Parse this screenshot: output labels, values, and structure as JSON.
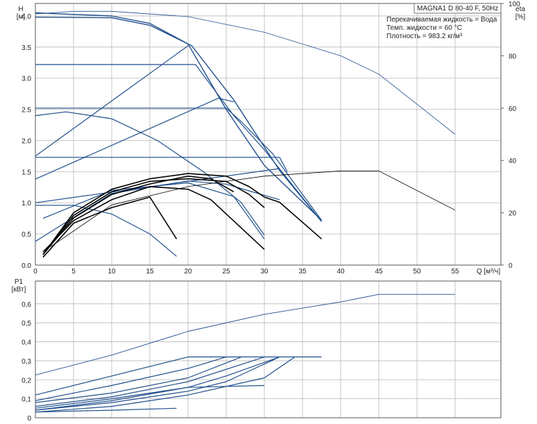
{
  "chart_data": [
    {
      "type": "line",
      "title": "MAGNA1 D 80-40 F, 50Hz",
      "ylabel": "H",
      "yunit": "[м]",
      "y2label": "eta",
      "y2unit": "[%]",
      "xlabel": "Q [м³/ч]",
      "xlim": [
        0,
        61
      ],
      "ylim": [
        0,
        4.2
      ],
      "y2lim": [
        0,
        100
      ],
      "xticks": [
        0,
        5,
        10,
        15,
        20,
        25,
        30,
        35,
        40,
        45,
        50,
        55
      ],
      "yticks": [
        0.0,
        0.5,
        1.0,
        1.5,
        2.0,
        2.5,
        3.0,
        3.5,
        4.0
      ],
      "y2ticks": [
        0,
        20,
        40,
        60,
        80,
        100
      ],
      "grid": true,
      "info_lines": [
        "Перекачиваемая жидкость = Вода",
        "Темп. жидкости = 60 °C",
        "Плотность = 983.2 кг/м³"
      ],
      "colors": {
        "curve": "#1f4e8c",
        "efficiency": "#000000",
        "grid": "#b8b8b8"
      },
      "series": [
        {
          "role": "max-curve",
          "points": [
            [
              0,
              4.05
            ],
            [
              10,
              4.0
            ],
            [
              15,
              3.88
            ],
            [
              20,
              3.55
            ],
            [
              25,
              2.5
            ],
            [
              30,
              1.6
            ],
            [
              37.5,
              0.72
            ]
          ]
        },
        {
          "role": "max-curve-alt",
          "points": [
            [
              0,
              3.98
            ],
            [
              10,
              3.97
            ],
            [
              15,
              3.85
            ],
            [
              20.5,
              3.52
            ],
            [
              26,
              2.65
            ],
            [
              32,
              1.52
            ],
            [
              37.5,
              0.7
            ]
          ]
        },
        {
          "role": "const-pressure",
          "points": [
            [
              0,
              3.22
            ],
            [
              21,
              3.22
            ],
            [
              22,
              3.05
            ],
            [
              26,
              2.4
            ],
            [
              30,
              1.85
            ],
            [
              37.5,
              0.7
            ]
          ]
        },
        {
          "role": "const-pressure",
          "points": [
            [
              0,
              2.52
            ],
            [
              25,
              2.52
            ],
            [
              27,
              2.3
            ],
            [
              31,
              1.8
            ],
            [
              37.5,
              0.72
            ]
          ]
        },
        {
          "role": "const-pressure",
          "points": [
            [
              0,
              1.73
            ],
            [
              32,
              1.73
            ],
            [
              33,
              1.5
            ]
          ]
        },
        {
          "role": "prop-pressure",
          "points": [
            [
              0,
              1.75
            ],
            [
              20,
              3.52
            ]
          ]
        },
        {
          "role": "prop-pressure",
          "points": [
            [
              0,
              1.38
            ],
            [
              24,
              2.68
            ],
            [
              26,
              2.62
            ]
          ]
        },
        {
          "role": "prop-pressure",
          "points": [
            [
              0,
              1.0
            ],
            [
              32,
              1.55
            ]
          ]
        },
        {
          "role": "speed-curve",
          "points": [
            [
              0,
              2.4
            ],
            [
              4,
              2.46
            ],
            [
              10,
              2.35
            ],
            [
              16,
              2.0
            ],
            [
              22,
              1.5
            ],
            [
              27,
              1.0
            ],
            [
              30,
              0.48
            ]
          ]
        },
        {
          "role": "speed-curve",
          "points": [
            [
              0,
              0.96
            ],
            [
              5,
              0.96
            ],
            [
              10,
              0.82
            ],
            [
              15,
              0.5
            ],
            [
              18.5,
              0.14
            ]
          ]
        },
        {
          "role": "speed-curve",
          "points": [
            [
              0,
              0.38
            ],
            [
              10,
              1.15
            ],
            [
              20,
              1.35
            ],
            [
              25,
              1.3
            ],
            [
              30,
              1.12
            ],
            [
              32,
              1.05
            ]
          ]
        },
        {
          "role": "speed-curve",
          "points": [
            [
              1,
              0.75
            ],
            [
              10,
              1.2
            ],
            [
              20,
              1.32
            ],
            [
              26,
              1.1
            ],
            [
              30,
              0.42
            ]
          ]
        },
        {
          "role": "p1-max",
          "points": [
            [
              0,
              0.225
            ],
            [
              10,
              0.33
            ],
            [
              20,
              0.455
            ],
            [
              30,
              0.545
            ],
            [
              40,
              0.61
            ],
            [
              45,
              0.65
            ],
            [
              55,
              0.65
            ]
          ]
        },
        {
          "role": "p1-limit",
          "points": [
            [
              20,
              0.32
            ],
            [
              37.5,
              0.32
            ]
          ]
        },
        {
          "role": "p1-curve",
          "points": [
            [
              0,
              0.12
            ],
            [
              10,
              0.22
            ],
            [
              20,
              0.32
            ]
          ]
        },
        {
          "role": "p1-curve",
          "points": [
            [
              0,
              0.09
            ],
            [
              10,
              0.17
            ],
            [
              20,
              0.26
            ],
            [
              25,
              0.32
            ]
          ]
        },
        {
          "role": "p1-curve",
          "points": [
            [
              0,
              0.08
            ],
            [
              10,
              0.13
            ],
            [
              20,
              0.21
            ],
            [
              27,
              0.32
            ]
          ]
        },
        {
          "role": "p1-curve",
          "points": [
            [
              0,
              0.06
            ],
            [
              10,
              0.11
            ],
            [
              20,
              0.19
            ],
            [
              30,
              0.32
            ]
          ]
        },
        {
          "role": "p1-curve",
          "points": [
            [
              0,
              0.05
            ],
            [
              10,
              0.1
            ],
            [
              20,
              0.16
            ],
            [
              25,
              0.22
            ],
            [
              32,
              0.32
            ]
          ]
        },
        {
          "role": "p1-curve",
          "points": [
            [
              0,
              0.04
            ],
            [
              10,
              0.08
            ],
            [
              20,
              0.14
            ],
            [
              25,
              0.19
            ],
            [
              32,
              0.32
            ]
          ]
        },
        {
          "role": "p1-curve",
          "points": [
            [
              0,
              0.03
            ],
            [
              10,
              0.06
            ],
            [
              20,
              0.12
            ],
            [
              30,
              0.21
            ],
            [
              34,
              0.32
            ]
          ]
        },
        {
          "role": "p1-curve",
          "points": [
            [
              0,
              0.04
            ],
            [
              10,
              0.09
            ],
            [
              20,
              0.16
            ],
            [
              30,
              0.17
            ]
          ]
        },
        {
          "role": "p1-curve",
          "points": [
            [
              0,
              0.03
            ],
            [
              10,
              0.04
            ],
            [
              18.5,
              0.05
            ]
          ]
        }
      ],
      "efficiency_series": [
        {
          "points": [
            [
              0,
              96
            ],
            [
              5,
              97
            ],
            [
              10,
              97
            ],
            [
              20,
              95
            ],
            [
              30,
              89
            ],
            [
              40,
              80
            ],
            [
              45,
              73
            ],
            [
              55,
              50
            ]
          ]
        },
        {
          "points": [
            [
              2,
              7
            ],
            [
              10,
              23
            ],
            [
              20,
              30
            ],
            [
              30,
              34
            ],
            [
              40,
              36
            ],
            [
              45,
              36
            ],
            [
              55,
              21
            ]
          ]
        },
        {
          "points": [
            [
              1,
              4
            ],
            [
              5,
              20
            ],
            [
              10,
              29
            ],
            [
              15,
              33
            ],
            [
              20,
              35
            ],
            [
              25,
              34
            ],
            [
              28,
              30
            ],
            [
              30,
              26
            ],
            [
              32,
              24
            ],
            [
              37.5,
              10
            ]
          ]
        },
        {
          "points": [
            [
              1,
              4
            ],
            [
              5,
              19
            ],
            [
              10,
              28
            ],
            [
              15,
              32
            ],
            [
              20,
              33
            ],
            [
              25,
              32
            ],
            [
              28,
              27
            ],
            [
              30,
              22
            ]
          ]
        },
        {
          "points": [
            [
              1,
              4
            ],
            [
              5,
              18
            ],
            [
              10,
              27
            ],
            [
              15,
              31
            ],
            [
              20,
              34
            ],
            [
              23,
              33
            ],
            [
              26,
              28
            ]
          ]
        },
        {
          "points": [
            [
              1,
              5
            ],
            [
              5,
              17
            ],
            [
              10,
              25
            ],
            [
              15,
              30
            ],
            [
              20,
              29
            ],
            [
              23,
              25
            ],
            [
              30,
              6
            ]
          ]
        },
        {
          "points": [
            [
              1,
              3
            ],
            [
              5,
              16
            ],
            [
              10,
              22
            ],
            [
              15,
              26
            ],
            [
              18.5,
              10
            ]
          ]
        }
      ]
    },
    {
      "type": "line",
      "ylabel": "P1",
      "yunit": "[кВт]",
      "xlim": [
        0,
        61
      ],
      "ylim": [
        0,
        0.72
      ],
      "yticks": [
        0,
        0.1,
        0.2,
        0.3,
        0.4,
        0.5,
        0.6
      ],
      "ytick_labels": [
        "0",
        "0,1",
        "0,2",
        "0,3",
        "0,4",
        "0,5",
        "0,6"
      ],
      "grid": true
    }
  ]
}
